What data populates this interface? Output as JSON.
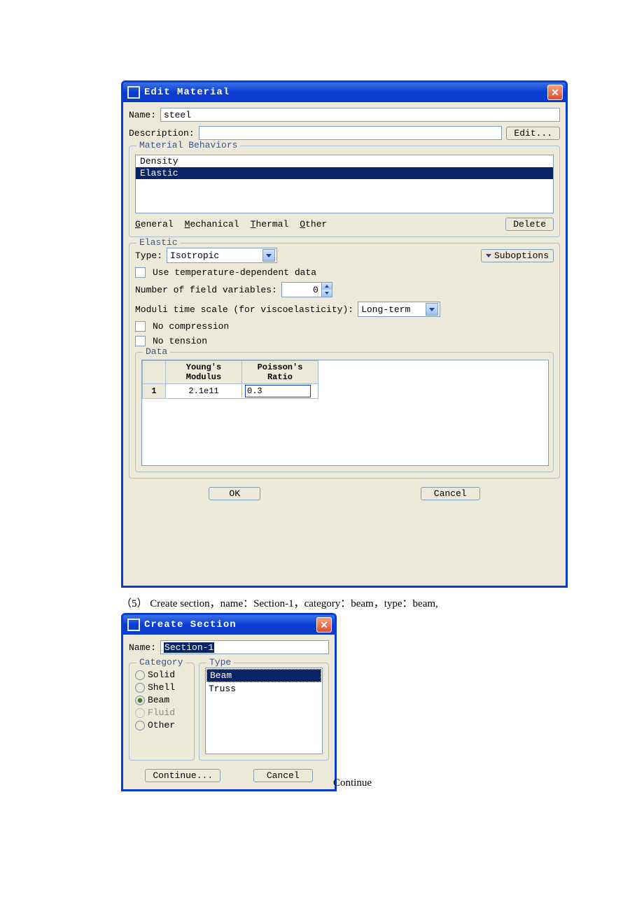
{
  "dialog1": {
    "title": "Edit Material",
    "name_label": "Name:",
    "name_value": "steel",
    "desc_label": "Description:",
    "desc_value": "",
    "edit_btn": "Edit...",
    "behaviors": {
      "legend": "Material Behaviors",
      "items": [
        "Density",
        "Elastic"
      ],
      "selected_index": 1,
      "menus": {
        "general": "General",
        "mechanical": "Mechanical",
        "thermal": "Thermal",
        "other": "Other"
      },
      "delete_btn": "Delete"
    },
    "elastic": {
      "legend": "Elastic",
      "type_label": "Type:",
      "type_value": "Isotropic",
      "suboptions": "Suboptions",
      "tempdep_label": "Use temperature-dependent data",
      "fieldvars_label": "Number of field variables:",
      "fieldvars_value": "0",
      "moduli_label": "Moduli time scale (for viscoelasticity):",
      "moduli_value": "Long-term",
      "nocomp_label": "No compression",
      "notens_label": "No tension",
      "data": {
        "legend": "Data",
        "headers": [
          "Young's\nModulus",
          "Poisson's\nRatio"
        ],
        "row": {
          "num": "1",
          "ym": "2.1e11",
          "pr": "0.3"
        }
      }
    },
    "ok": "OK",
    "cancel": "Cancel"
  },
  "caption": "（5）  Create section，name：Section-1，category：beam，type：beam,",
  "dialog2": {
    "title": "Create Section",
    "name_label": "Name:",
    "name_value": "Section-1",
    "category": {
      "legend": "Category",
      "items": [
        "Solid",
        "Shell",
        "Beam",
        "Fluid",
        "Other"
      ],
      "selected": "Beam",
      "disabled": [
        "Fluid"
      ]
    },
    "type": {
      "legend": "Type",
      "items": [
        "Beam",
        "Truss"
      ],
      "selected": "Beam"
    },
    "continue": "Continue...",
    "cancel": "Cancel"
  },
  "trailing": "Continue"
}
